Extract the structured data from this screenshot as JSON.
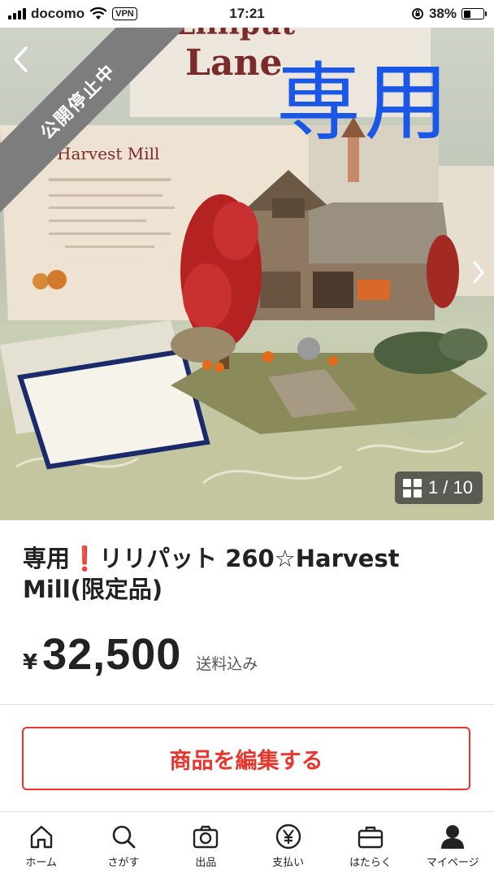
{
  "status_bar": {
    "carrier": "docomo",
    "vpn": "VPN",
    "time": "17:21",
    "battery": "38%",
    "battery_level": 0.38
  },
  "photo": {
    "status_banner": "公開停止中",
    "overlay_text": "専用",
    "counter": "1 / 10",
    "certificate_title": "Harvest Mill",
    "box_brand_line1": "Lilliput",
    "box_brand_line2": "Lane"
  },
  "item": {
    "title": "専用❗️リリパット 260☆Harvest Mill(限定品)",
    "currency": "¥",
    "price": "32,500",
    "shipping": "送料込み"
  },
  "actions": {
    "edit_label": "商品を編集する"
  },
  "tabbar": {
    "items": [
      {
        "label": "ホーム",
        "icon": "home-icon"
      },
      {
        "label": "さがす",
        "icon": "search-icon"
      },
      {
        "label": "出品",
        "icon": "camera-icon"
      },
      {
        "label": "支払い",
        "icon": "yen-icon"
      },
      {
        "label": "はたらく",
        "icon": "briefcase-icon"
      },
      {
        "label": "マイページ",
        "icon": "person-icon"
      }
    ]
  }
}
